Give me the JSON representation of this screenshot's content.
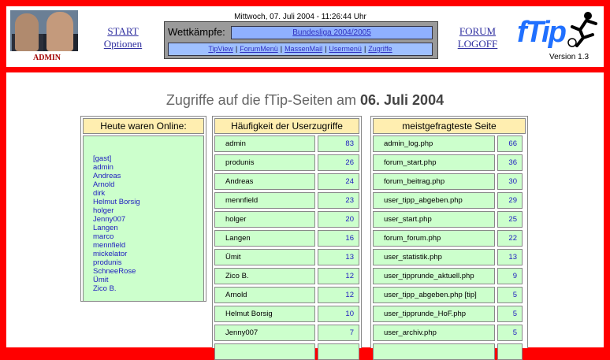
{
  "header": {
    "user_label": "ADMIN",
    "start_link": "START",
    "options_link": "Optionen",
    "date_time": "Mittwoch, 07. Juli 2004 - 11:26:44 Uhr",
    "competitions_label": "Wettkämpfe:",
    "competition_selected": "Bundesliga 2004/2005",
    "menu_items": [
      "TipView",
      "ForumMenü",
      "MassenMail",
      "Usermenü",
      "Zugriffe"
    ],
    "forum_link": "FORUM",
    "logoff_link": "LOGOFF",
    "logo_text": "fTip",
    "version": "Version 1.3"
  },
  "main": {
    "title_prefix": "Zugriffe auf die fTip-Seiten am ",
    "title_date": "06. Juli 2004",
    "online": {
      "header": "Heute waren Online:",
      "users": [
        "[gast]",
        "admin",
        "Andreas",
        "Arnold",
        "dirk",
        "Helmut Borsig",
        "holger",
        "Jenny007",
        "Langen",
        "marco",
        "mennfield",
        "mickelator",
        "produnis",
        "SchneeRose",
        "Ümit",
        "Zico B."
      ]
    },
    "user_access": {
      "header": "Häufigkeit der Userzugriffe",
      "rows": [
        {
          "name": "admin",
          "count": "83"
        },
        {
          "name": "produnis",
          "count": "26"
        },
        {
          "name": "Andreas",
          "count": "24"
        },
        {
          "name": "mennfield",
          "count": "23"
        },
        {
          "name": "holger",
          "count": "20"
        },
        {
          "name": "Langen",
          "count": "16"
        },
        {
          "name": "Ümit",
          "count": "13"
        },
        {
          "name": "Zico B.",
          "count": "12"
        },
        {
          "name": "Arnold",
          "count": "12"
        },
        {
          "name": "Helmut Borsig",
          "count": "10"
        },
        {
          "name": "Jenny007",
          "count": "7"
        }
      ]
    },
    "top_pages": {
      "header": "meistgefragteste Seite",
      "rows": [
        {
          "name": "admin_log.php",
          "count": "66"
        },
        {
          "name": "forum_start.php",
          "count": "36"
        },
        {
          "name": "forum_beitrag.php",
          "count": "30"
        },
        {
          "name": "user_tipp_abgeben.php",
          "count": "29"
        },
        {
          "name": "user_start.php",
          "count": "25"
        },
        {
          "name": "forum_forum.php",
          "count": "22"
        },
        {
          "name": "user_statistik.php",
          "count": "13"
        },
        {
          "name": "user_tipprunde_aktuell.php",
          "count": "9"
        },
        {
          "name": "user_tipp_abgeben.php [tip]",
          "count": "5"
        },
        {
          "name": "user_tipprunde_HoF.php",
          "count": "5"
        },
        {
          "name": "user_archiv.php",
          "count": "5"
        }
      ]
    }
  }
}
